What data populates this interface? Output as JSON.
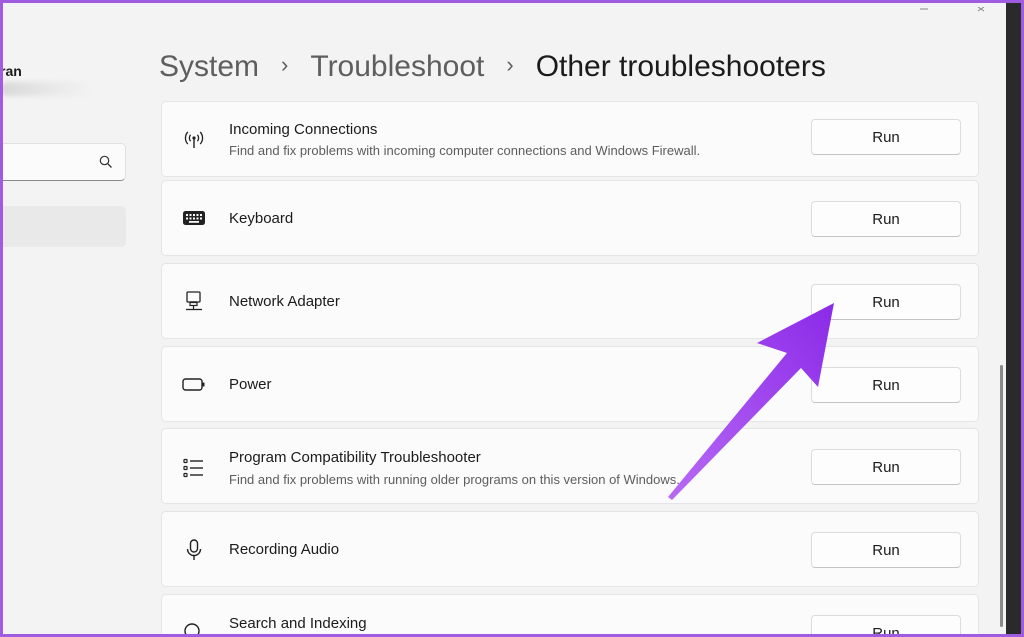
{
  "sidebar": {
    "user_name": "ran",
    "search": {
      "value": "",
      "placeholder": ""
    }
  },
  "breadcrumb": {
    "items": [
      "System",
      "Troubleshoot"
    ],
    "current": "Other troubleshooters",
    "separator": "›"
  },
  "troubleshooters": [
    {
      "title": "Incoming Connections",
      "description": "Find and fix problems with incoming computer connections and Windows Firewall.",
      "icon": "wifi-antenna-icon",
      "button": "Run"
    },
    {
      "title": "Keyboard",
      "description": "",
      "icon": "keyboard-icon",
      "button": "Run"
    },
    {
      "title": "Network Adapter",
      "description": "",
      "icon": "network-computer-icon",
      "button": "Run"
    },
    {
      "title": "Power",
      "description": "",
      "icon": "battery-icon",
      "button": "Run"
    },
    {
      "title": "Program Compatibility Troubleshooter",
      "description": "Find and fix problems with running older programs on this version of Windows.",
      "icon": "list-icon",
      "button": "Run"
    },
    {
      "title": "Recording Audio",
      "description": "",
      "icon": "microphone-icon",
      "button": "Run"
    },
    {
      "title": "Search and Indexing",
      "description": "",
      "icon": "search-icon",
      "button": "Run"
    }
  ],
  "colors": {
    "annotation_arrow": "#9b3df0",
    "frame": "#a05ce0",
    "background": "#f3f3f3",
    "card": "#fbfbfb"
  }
}
